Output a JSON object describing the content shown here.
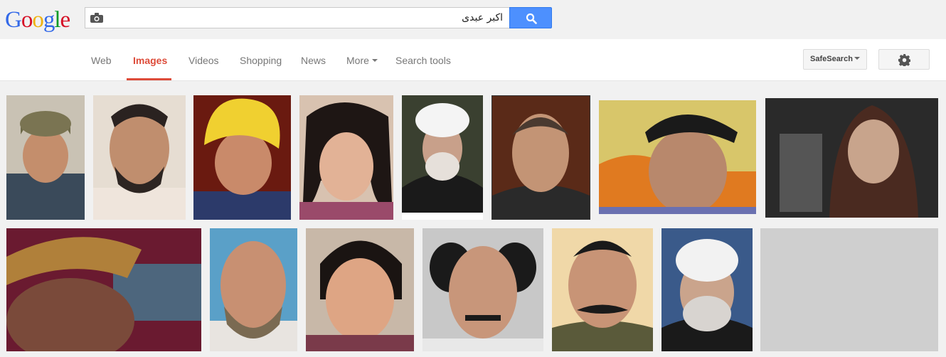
{
  "logo": {
    "letters": [
      "G",
      "o",
      "o",
      "g",
      "l",
      "e"
    ],
    "colors": [
      "#3369e8",
      "#d50f25",
      "#eeb211",
      "#3369e8",
      "#009925",
      "#d50f25"
    ]
  },
  "search": {
    "query": "اکبر عبدی",
    "camera_icon": "camera-icon",
    "button_icon": "search-icon",
    "button_color": "#4d90fe"
  },
  "nav": {
    "tabs": [
      "Web",
      "Images",
      "Videos",
      "Shopping",
      "News",
      "More",
      "Search tools"
    ],
    "active": "Images",
    "active_color": "#dd4b39"
  },
  "tools": {
    "safesearch": "SafeSearch",
    "settings_icon": "gear-icon"
  },
  "images": {
    "count": 15
  }
}
